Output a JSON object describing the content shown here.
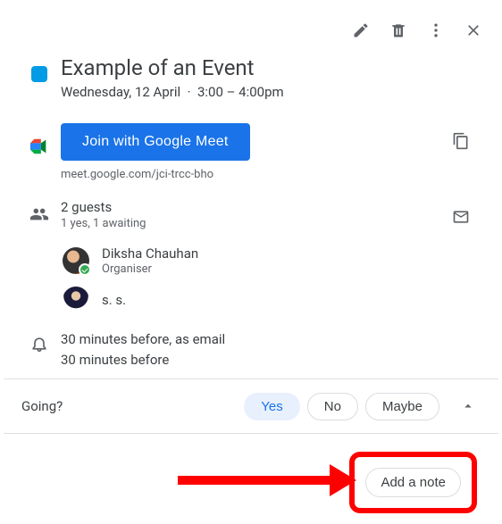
{
  "event": {
    "color": "#039be5",
    "title": "Example of an Event",
    "date": "Wednesday, 12 April",
    "time": "3:00 – 4:00pm"
  },
  "meet": {
    "button_label": "Join with Google Meet",
    "link_text": "meet.google.com/jci-trcc-bho"
  },
  "guests": {
    "count_text": "2 guests",
    "status_text": "1 yes, 1 awaiting",
    "list": [
      {
        "name": "Diksha Chauhan",
        "role": "Organiser",
        "rsvp": "yes"
      },
      {
        "name": "s. s.",
        "role": "",
        "rsvp": "awaiting"
      }
    ]
  },
  "notifications": {
    "lines": [
      "30 minutes before, as email",
      "30 minutes before"
    ]
  },
  "rsvp": {
    "label": "Going?",
    "yes": "Yes",
    "no": "No",
    "maybe": "Maybe",
    "selected": "yes"
  },
  "actions": {
    "add_note": "Add a note"
  },
  "icons": {
    "edit": "pencil-icon",
    "delete": "trash-icon",
    "menu": "more-vertical-icon",
    "close": "close-icon",
    "copy": "copy-icon",
    "email": "envelope-icon",
    "guests": "guests-icon",
    "bell": "bell-icon",
    "meet": "google-meet-icon",
    "chevron": "chevron-up-icon"
  }
}
